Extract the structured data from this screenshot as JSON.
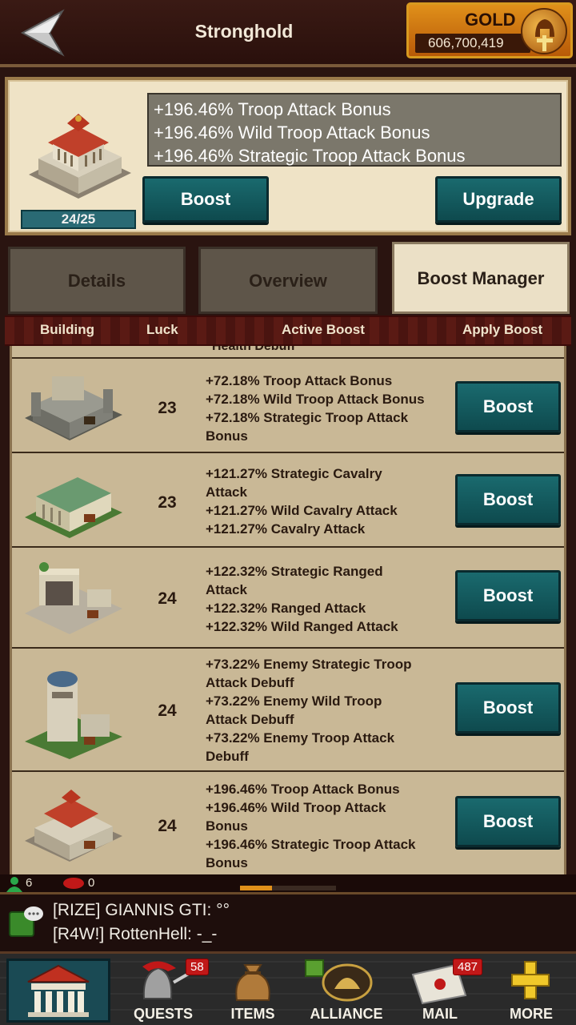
{
  "header": {
    "title": "Stronghold",
    "gold_label": "GOLD",
    "gold_value": "606,700,419"
  },
  "building": {
    "level": "24/25",
    "bonuses": [
      "+196.46% Troop Attack Bonus",
      "+196.46% Wild Troop Attack Bonus",
      "+196.46% Strategic Troop Attack Bonus"
    ],
    "boost_label": "Boost",
    "upgrade_label": "Upgrade"
  },
  "tabs": [
    {
      "label": "Details"
    },
    {
      "label": "Overview"
    },
    {
      "label": "Boost Manager",
      "active": true
    }
  ],
  "columns": [
    "Building",
    "Luck",
    "Active Boost",
    "Apply Boost"
  ],
  "partial_text": "Health Debuff",
  "rows": [
    {
      "luck": "23",
      "effects": [
        "+72.18% Troop Attack Bonus",
        "+72.18% Wild Troop Attack Bonus",
        "+72.18% Strategic Troop Attack",
        "Bonus"
      ],
      "button": "Boost"
    },
    {
      "luck": "23",
      "effects": [
        "+121.27% Strategic Cavalry",
        "Attack",
        "+121.27% Wild Cavalry Attack",
        "+121.27% Cavalry Attack"
      ],
      "button": "Boost"
    },
    {
      "luck": "24",
      "effects": [
        "+122.32% Strategic Ranged",
        "Attack",
        "+122.32% Ranged Attack",
        "+122.32% Wild Ranged Attack"
      ],
      "button": "Boost"
    },
    {
      "luck": "24",
      "effects": [
        "+73.22% Enemy Strategic Troop",
        "Attack Debuff",
        "+73.22% Enemy Wild Troop",
        "Attack Debuff",
        "+73.22% Enemy Troop Attack",
        "Debuff"
      ],
      "button": "Boost"
    },
    {
      "luck": "24",
      "effects": [
        "+196.46% Troop Attack Bonus",
        "+196.46% Wild Troop Attack",
        "Bonus",
        "+196.46% Strategic Troop Attack",
        "Bonus"
      ],
      "button": "Boost"
    }
  ],
  "online": {
    "players": "6",
    "alliance": "0"
  },
  "chat": [
    "[RIZE] GIANNIS GTI: °°",
    "[R4W!] RottenHell: -_-"
  ],
  "nav": {
    "quests": {
      "label": "QUESTS",
      "badge": "58"
    },
    "items": {
      "label": "ITEMS"
    },
    "alliance": {
      "label": "ALLIANCE"
    },
    "mail": {
      "label": "MAIL",
      "badge": "487"
    },
    "more": {
      "label": "MORE"
    }
  },
  "colors": {
    "teal_button": "#1a6a6e",
    "gold_accent": "#e0901a",
    "panel": "#efe3c6"
  }
}
